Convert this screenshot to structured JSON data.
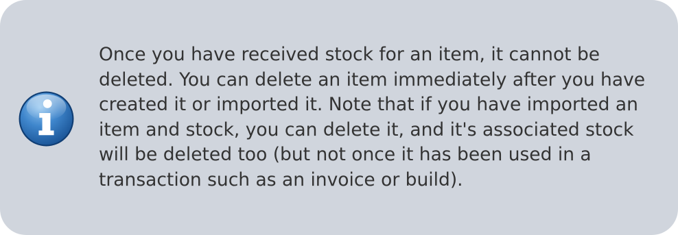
{
  "note": {
    "icon": "info-icon",
    "accent_color": "#1a5a9c",
    "background_color": "#d0d5dd",
    "text_color": "#333333",
    "lines": [
      "Once you have received stock for an item, it cannot be",
      "deleted. You can delete an item immediately after you have",
      "created it or imported it. Note that if you have imported an",
      "item and stock, you can delete it, and it's associated stock",
      "will be deleted too (but not once it has been used in a",
      "transaction such as an invoice or build)."
    ]
  }
}
